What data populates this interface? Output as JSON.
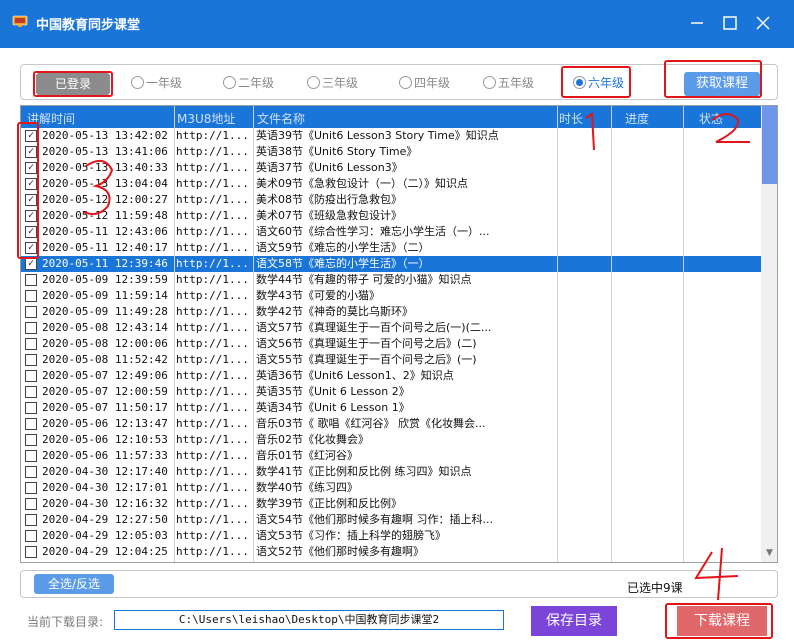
{
  "window": {
    "title": "中国教育同步课堂",
    "icon": "app-tv-icon",
    "controls": [
      "minimize-icon",
      "maximize-icon",
      "close-icon"
    ]
  },
  "grade_bar": {
    "logged_in_label": "已登录",
    "grades": [
      {
        "label": "一年级",
        "checked": false
      },
      {
        "label": "二年级",
        "checked": false
      },
      {
        "label": "三年级",
        "checked": false
      },
      {
        "label": "四年级",
        "checked": false
      },
      {
        "label": "五年级",
        "checked": false
      },
      {
        "label": "六年级",
        "checked": true
      }
    ],
    "fetch_label": "获取课程"
  },
  "table": {
    "headers": {
      "time": "讲解时间",
      "url": "M3U8地址",
      "name": "文件名称",
      "duration": "时长",
      "progress": "进度",
      "status": "状态"
    },
    "rows": [
      {
        "checked": true,
        "time": "2020-05-13 13:42:02",
        "url": "http://1...",
        "name": "英语39节《Unit6 Lesson3 Story Time》知识点"
      },
      {
        "checked": true,
        "time": "2020-05-13 13:41:06",
        "url": "http://1...",
        "name": "英语38节《Unit6 Story Time》"
      },
      {
        "checked": true,
        "time": "2020-05-13 13:40:33",
        "url": "http://1...",
        "name": "英语37节《Unit6 Lesson3》"
      },
      {
        "checked": true,
        "time": "2020-05-13 13:04:04",
        "url": "http://1...",
        "name": "美术09节《急救包设计（一）（二）》知识点"
      },
      {
        "checked": true,
        "time": "2020-05-12 12:00:27",
        "url": "http://1...",
        "name": "美术08节《防疫出行急救包》"
      },
      {
        "checked": true,
        "time": "2020-05-12 11:59:48",
        "url": "http://1...",
        "name": "美术07节《班级急救包设计》"
      },
      {
        "checked": true,
        "time": "2020-05-11 12:43:06",
        "url": "http://1...",
        "name": "语文60节《综合性学习：难忘小学生活（一）..."
      },
      {
        "checked": true,
        "time": "2020-05-11 12:40:17",
        "url": "http://1...",
        "name": "语文59节《难忘的小学生活》（二）"
      },
      {
        "checked": true,
        "selected": true,
        "time": "2020-05-11 12:39:46",
        "url": "http://1...",
        "name": "语文58节《难忘的小学生活》（一）"
      },
      {
        "checked": false,
        "time": "2020-05-09 12:39:59",
        "url": "http://1...",
        "name": "数学44节《有趣的带子 可爱的小猫》知识点"
      },
      {
        "checked": false,
        "time": "2020-05-09 11:59:14",
        "url": "http://1...",
        "name": "数学43节《可爱的小猫》"
      },
      {
        "checked": false,
        "time": "2020-05-09 11:49:28",
        "url": "http://1...",
        "name": "数学42节《神奇的莫比乌斯环》"
      },
      {
        "checked": false,
        "time": "2020-05-08 12:43:14",
        "url": "http://1...",
        "name": "语文57节《真理诞生于一百个问号之后(一)(二..."
      },
      {
        "checked": false,
        "time": "2020-05-08 12:00:06",
        "url": "http://1...",
        "name": "语文56节《真理诞生于一百个问号之后》(二)"
      },
      {
        "checked": false,
        "time": "2020-05-08 11:52:42",
        "url": "http://1...",
        "name": "语文55节《真理诞生于一百个问号之后》(一)"
      },
      {
        "checked": false,
        "time": "2020-05-07 12:49:06",
        "url": "http://1...",
        "name": "英语36节《Unit6 Lesson1、2》知识点"
      },
      {
        "checked": false,
        "time": "2020-05-07 12:00:59",
        "url": "http://1...",
        "name": "英语35节《Unit 6 Lesson 2》"
      },
      {
        "checked": false,
        "time": "2020-05-07 11:50:17",
        "url": "http://1...",
        "name": "英语34节《Unit 6 Lesson 1》"
      },
      {
        "checked": false,
        "time": "2020-05-06 12:13:47",
        "url": "http://1...",
        "name": "音乐03节《 歌唱《红河谷》 欣赏《化妆舞会..."
      },
      {
        "checked": false,
        "time": "2020-05-06 12:10:53",
        "url": "http://1...",
        "name": "音乐02节《化妆舞会》"
      },
      {
        "checked": false,
        "time": "2020-05-06 11:57:33",
        "url": "http://1...",
        "name": "音乐01节《红河谷》"
      },
      {
        "checked": false,
        "time": "2020-04-30 12:17:40",
        "url": "http://1...",
        "name": "数学41节《正比例和反比例 练习四》知识点"
      },
      {
        "checked": false,
        "time": "2020-04-30 12:17:01",
        "url": "http://1...",
        "name": "数学40节《练习四》"
      },
      {
        "checked": false,
        "time": "2020-04-30 12:16:32",
        "url": "http://1...",
        "name": "数学39节《正比例和反比例》"
      },
      {
        "checked": false,
        "time": "2020-04-29 12:27:50",
        "url": "http://1...",
        "name": "语文54节《他们那时候多有趣啊 习作：插上科..."
      },
      {
        "checked": false,
        "time": "2020-04-29 12:05:03",
        "url": "http://1...",
        "name": "语文53节《习作：插上科学的翅膀飞》"
      },
      {
        "checked": false,
        "time": "2020-04-29 12:04:25",
        "url": "http://1...",
        "name": "语文52节《他们那时候多有趣啊》"
      }
    ]
  },
  "bottom": {
    "select_all_label": "全选/反选",
    "selected_count": "已选中9课"
  },
  "download": {
    "dir_label": "当前下载目录:",
    "dir_value": "C:\\Users\\leishao\\Desktop\\中国教育同步课堂2",
    "save_dir_label": "保存目录",
    "download_label": "下载课程"
  },
  "annotations": {
    "color": "#e0161b",
    "numbers": [
      "1",
      "2",
      "3",
      "4"
    ]
  },
  "colors": {
    "accent": "#1a75d8",
    "save_button": "#7a45d8",
    "download_button": "#e0676a",
    "logged_button": "#8c8c8c"
  }
}
